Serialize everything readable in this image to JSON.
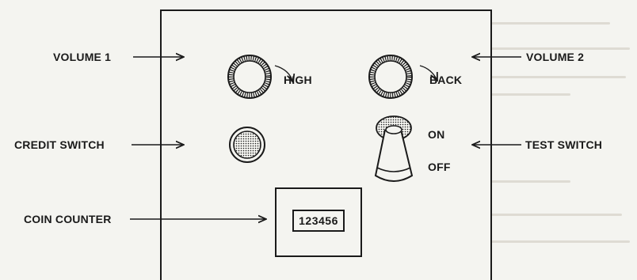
{
  "labels": {
    "volume1": "VOLUME 1",
    "volume2": "VOLUME 2",
    "credit_switch": "CREDIT SWITCH",
    "test_switch": "TEST SWITCH",
    "coin_counter": "COIN COUNTER",
    "high": "HIGH",
    "back": "BACK",
    "on": "ON",
    "off": "OFF"
  },
  "counter": {
    "value": "123456"
  },
  "colors": {
    "ink": "#1a1a1a",
    "paper": "#f4f4f0",
    "stipple": "#9a9a9a"
  }
}
